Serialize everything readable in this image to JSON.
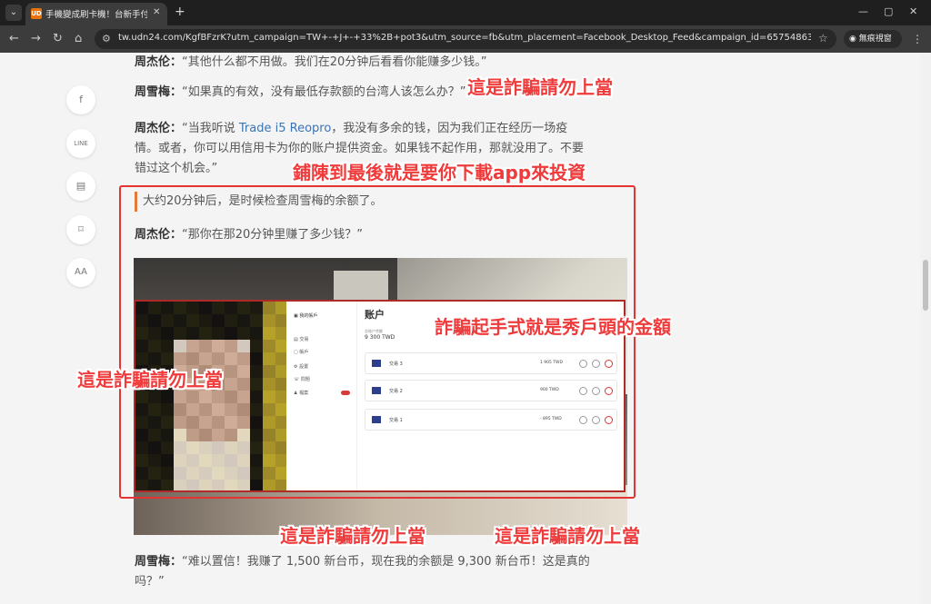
{
  "browser": {
    "tab_title": "手機變成刷卡機！台新手付 APP",
    "tab_favicon": "UD",
    "url": "tw.udn24.com/KgfBFzrK?utm_campaign=TW+-+J+-+33%2B+pot3&utm_source=fb&utm_placement=Facebook_Desktop_Feed&campaign_id=6575486322865&adset_i...",
    "incognito_label": "無痕視窗",
    "icons": [
      "tab-search-icon",
      "favicon",
      "close-icon",
      "new-tab-icon",
      "minimize-icon",
      "maximize-icon",
      "close-window-icon",
      "back-icon",
      "forward-icon",
      "reload-icon",
      "home-icon",
      "site-info-icon",
      "bookmark-star-icon",
      "incognito-icon",
      "menu-icon"
    ]
  },
  "share": {
    "items": [
      {
        "icon": "facebook-icon",
        "glyph": "f"
      },
      {
        "icon": "line-icon",
        "glyph": "LINE"
      },
      {
        "icon": "comment-icon",
        "glyph": "▤"
      },
      {
        "icon": "bookmark-icon",
        "glyph": "⌑"
      },
      {
        "icon": "font-size-icon",
        "glyph": "AA"
      }
    ]
  },
  "article": {
    "p1": {
      "speaker": "周杰伦：",
      "text": "“其他什么都不用做。我们在20分钟后看看你能赚多少钱。”"
    },
    "p2": {
      "speaker": "周雪梅：",
      "text": "“如果真的有效，没有最低存款额的台湾人该怎么办？”"
    },
    "p3": {
      "speaker": "周杰伦：",
      "pre": "“当我听说 ",
      "link": "Trade i5 Reopro",
      "post_line1": "，我没有多余的钱，因为我们正在经历一场疫",
      "line2": "情。或者，你可以用信用卡为你的账户提供资金。如果钱不起作用，那就没用了。不要",
      "line3": "错过这个机会。”"
    },
    "quote": "大约20分钟后，是时候检查周雪梅的余额了。",
    "p4": {
      "speaker": "周杰伦：",
      "text": "“那你在那20分钟里赚了多少钱？”"
    },
    "p5": {
      "speaker": "周雪梅：",
      "line1": "“难以置信！我赚了 1,500 新台币，现在我的余额是 9,300 新台币！这是真的",
      "line2": "吗？”"
    }
  },
  "app": {
    "brand": "▣ 我的帳戶",
    "side_items": [
      "▤ 交易",
      "▢ 帳戶",
      "⚙ 設置",
      "☏ 問題",
      "♟ 檔案"
    ],
    "title": "账户",
    "balance_label": "总账户余额",
    "balance": "9 300 TWD",
    "trades": [
      {
        "name": "交易 3",
        "amount": "1 905 TWD"
      },
      {
        "name": "交易 2",
        "amount": "900 TWD"
      },
      {
        "name": "交易 1",
        "amount": "- 895 TWD"
      }
    ]
  },
  "annotations": {
    "a1": "這是詐騙請勿上當",
    "a2": "鋪陳到最後就是要你下載app來投資",
    "a3": "詐騙起手式就是秀戶頭的金額",
    "a4": "這是詐騙請勿上當",
    "a5": "這是詐騙請勿上當",
    "a6": "這是詐騙請勿上當"
  },
  "colors": {
    "annotation": "#ef3b3b",
    "link": "#3a74b7",
    "quote_bar": "#e0793a"
  }
}
